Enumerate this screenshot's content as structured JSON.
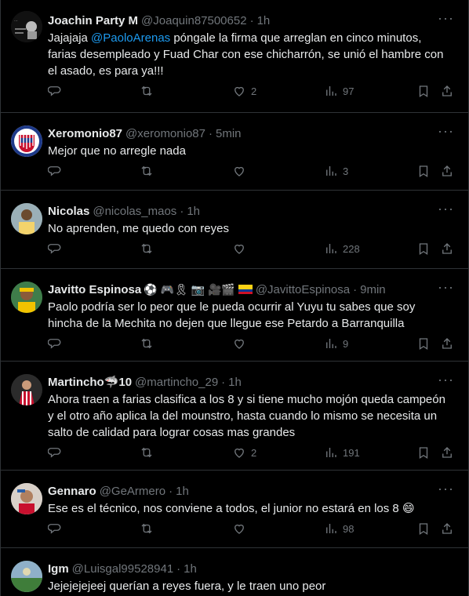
{
  "tweets": [
    {
      "name": "Joachin Party M",
      "handle": "@Joaquin87500652",
      "time": "1h",
      "text_pre": "Jajajaja ",
      "mention": "@PaoloArenas",
      "text_post": " póngale la firma que arreglan en cinco minutos, farias desempleado y Fuad Char con ese chicharrón, se unió el hambre con el asado, es para ya!!!",
      "likes": "2",
      "views": "97"
    },
    {
      "name": "Xeromonio87",
      "handle": "@xeromonio87",
      "time": "5min",
      "text": "Mejor que no arregle nada",
      "likes": "",
      "views": "3"
    },
    {
      "name": "Nicolas",
      "handle": "@nicolas_maos",
      "time": "1h",
      "text": "No aprenden, me quedo con reyes",
      "likes": "",
      "views": "228"
    },
    {
      "name": "Javitto Espinosa",
      "name_emojis": "⚽ 🎮🎗 📷 🎥🎬",
      "handle": "@JavittoEspinosa",
      "time": "9min",
      "text": "Paolo podría ser lo peor que le pueda ocurrir al Yuyu tu sabes que soy hincha de la Mechita no dejen que llegue ese Petardo a Barranquilla",
      "likes": "",
      "views": "9"
    },
    {
      "name": "Martincho",
      "name_suffix": "🦈10",
      "handle": "@martincho_29",
      "time": "1h",
      "text": "Ahora traen a farias clasifica a los 8 y si tiene mucho mojón queda campeón y el otro año aplica la del mounstro, hasta cuando lo mismo se necesita un salto de calidad para lograr cosas mas grandes",
      "likes": "2",
      "views": "191"
    },
    {
      "name": "Gennaro",
      "handle": "@GeArmero",
      "time": "1h",
      "text": "Ese es el técnico, nos conviene a todos, el junior no estará en los 8 😄",
      "likes": "",
      "views": "98"
    },
    {
      "name": "Igm",
      "handle": "@Luisgal99528941",
      "time": "1h",
      "text": "Jejejejejeej querían a reyes fuera, y le traen uno peor",
      "likes": "",
      "views": ""
    }
  ],
  "more_label": "···",
  "icons": [
    "reply-icon",
    "retweet-icon",
    "like-icon",
    "views-icon",
    "bookmark-icon",
    "share-icon"
  ],
  "colors": {
    "background": "#000000",
    "text": "#e7e9ea",
    "muted": "#71767b",
    "link": "#1d9bf0",
    "divider": "#2f3336"
  }
}
